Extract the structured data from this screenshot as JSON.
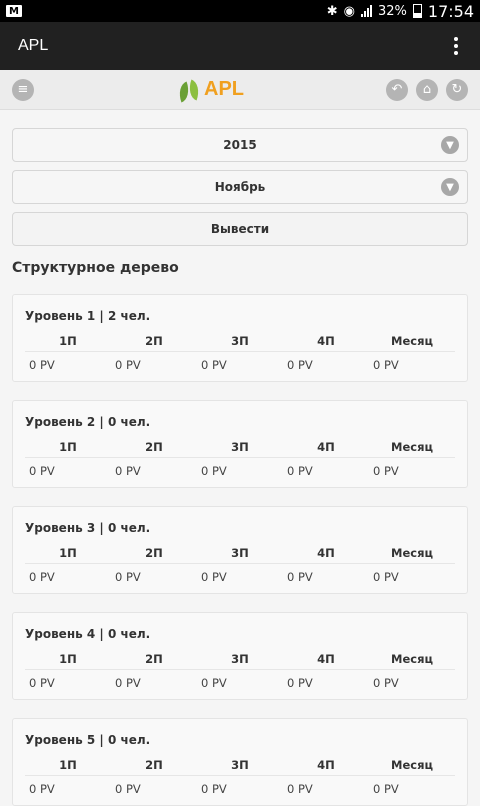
{
  "status": {
    "battery": "32%",
    "time": "17:54"
  },
  "app": {
    "title": "APL"
  },
  "logo": {
    "text": "APL"
  },
  "filters": {
    "year": "2015",
    "month": "Ноябрь",
    "submit": "Вывести"
  },
  "section": {
    "title": "Структурное дерево"
  },
  "columns": [
    "1П",
    "2П",
    "3П",
    "4П",
    "Месяц"
  ],
  "levels": [
    {
      "title": "Уровень 1 | 2 чел.",
      "values": [
        "0 PV",
        "0 PV",
        "0 PV",
        "0 PV",
        "0 PV"
      ]
    },
    {
      "title": "Уровень 2 | 0 чел.",
      "values": [
        "0 PV",
        "0 PV",
        "0 PV",
        "0 PV",
        "0 PV"
      ]
    },
    {
      "title": "Уровень 3 | 0 чел.",
      "values": [
        "0 PV",
        "0 PV",
        "0 PV",
        "0 PV",
        "0 PV"
      ]
    },
    {
      "title": "Уровень 4 | 0 чел.",
      "values": [
        "0 PV",
        "0 PV",
        "0 PV",
        "0 PV",
        "0 PV"
      ]
    },
    {
      "title": "Уровень 5 | 0 чел.",
      "values": [
        "0 PV",
        "0 PV",
        "0 PV",
        "0 PV",
        "0 PV"
      ]
    }
  ]
}
